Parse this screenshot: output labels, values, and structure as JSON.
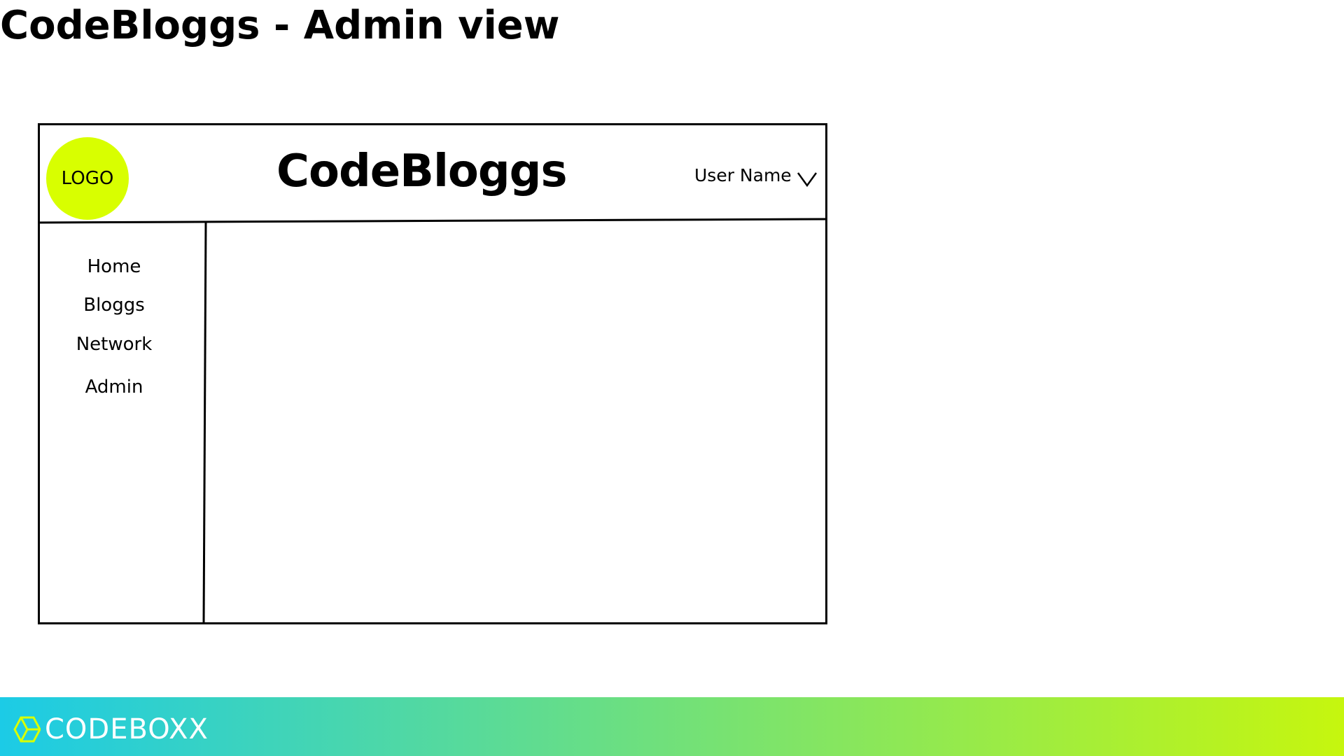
{
  "slide": {
    "title": "CodeBloggs - Admin view"
  },
  "wireframe": {
    "logo": {
      "label": "LOGO",
      "color": "#d8ff00"
    },
    "app_title": "CodeBloggs",
    "user_menu": {
      "label": "User Name",
      "icon": "chevron-down-icon"
    },
    "sidebar": {
      "items": [
        {
          "label": "Home"
        },
        {
          "label": "Bloggs"
        },
        {
          "label": "Network"
        },
        {
          "label": "Admin"
        }
      ]
    }
  },
  "footer": {
    "brand_name": "CODEBOXX",
    "brand_icon": "hexagon-logo-icon",
    "gradient_start": "#1ccbe6",
    "gradient_end": "#c6f60e"
  }
}
